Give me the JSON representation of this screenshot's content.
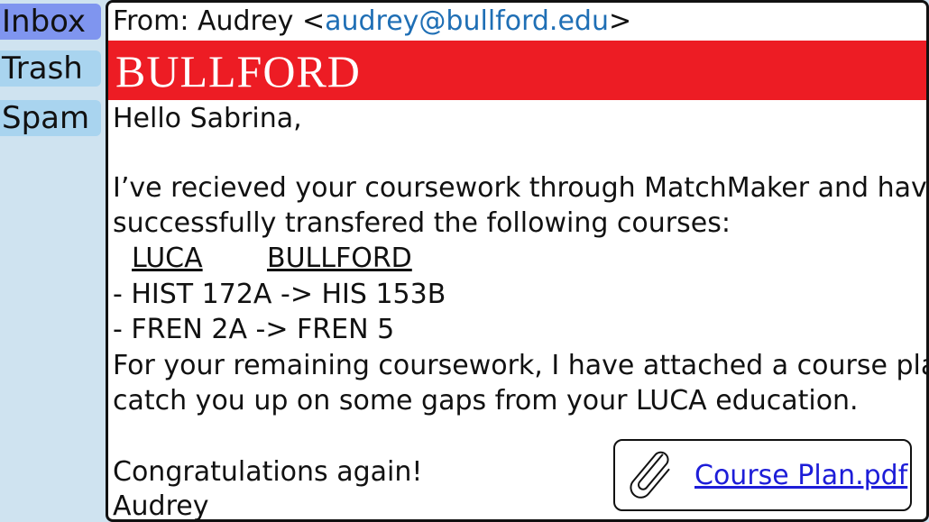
{
  "sidebar": {
    "items": [
      {
        "label": "Inbox",
        "active": true
      },
      {
        "label": "Trash",
        "active": false
      },
      {
        "label": "Spam",
        "active": false
      }
    ]
  },
  "email": {
    "from_prefix": "From: Audrey <",
    "from_address": "audrey@bullford.edu",
    "from_suffix": ">",
    "banner": "BULLFORD",
    "body": {
      "greeting": "Hello Sabrina,",
      "para1_line1": "I’ve recieved your coursework through MatchMaker and have",
      "para1_line2": "successfully transfered the following courses:",
      "col_luca": "LUCA",
      "col_bullford": "BULLFORD",
      "course1": "- HIST 172A -> HIS 153B",
      "course2": "- FREN 2A ->  FREN 5",
      "para2_line1": "For your remaining coursework, I have attached a course plan to",
      "para2_line2": "catch you up on some gaps from your LUCA education.",
      "closing": "Congratulations again!",
      "signature": "Audrey"
    },
    "attachment": {
      "icon": "paperclip-icon",
      "filename": "Course Plan.pdf"
    }
  },
  "colors": {
    "sidebar_bg": "#cfe3f0",
    "nav_item": "#a9d4ef",
    "nav_active": "#7f95ef",
    "banner": "#ed1c24",
    "email_link": "#1f6fb5",
    "attachment_link": "#1d1dd8"
  }
}
